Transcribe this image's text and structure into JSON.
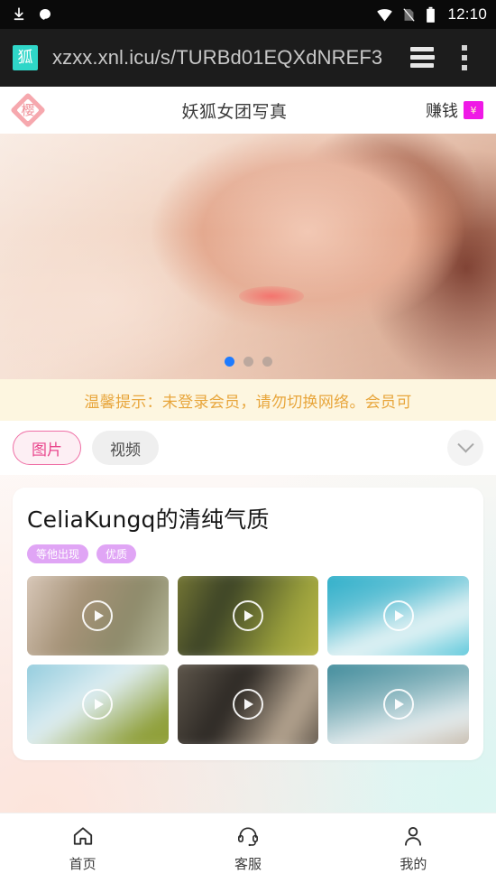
{
  "status_bar": {
    "time": "12:10",
    "left_icons": [
      "download-icon",
      "app-blob-icon"
    ],
    "right_icons": [
      "wifi-icon",
      "no-sim-icon",
      "battery-icon"
    ]
  },
  "browser": {
    "favicon_char": "狐",
    "url": "xzxx.xnl.icu/s/TURBd01EQXdNREF3",
    "tabs_icon": "tab-stack-icon",
    "menu_icon": "overflow-menu-icon"
  },
  "site_header": {
    "logo_char": "樱",
    "title": "妖狐女团写真",
    "earn_label": "赚钱",
    "earn_badge_char": "¥"
  },
  "banner": {
    "alt": "portrait-banner",
    "dots": [
      true,
      false,
      false
    ]
  },
  "notice": {
    "text": "温馨提示：未登录会员，请勿切换网络。会员可"
  },
  "tabs": {
    "items": [
      {
        "label": "图片",
        "active": true
      },
      {
        "label": "视频",
        "active": false
      }
    ],
    "expand_icon": "chevron-down-icon"
  },
  "card": {
    "title": "CeliaKungq的清纯气质",
    "tags": [
      "等他出现",
      "优质"
    ],
    "thumbnails": [
      {
        "id": 1,
        "play_icon": "play-icon",
        "c1": "#e8d8cd",
        "c2": "#8d8a6a",
        "c3": "#c9cdb0"
      },
      {
        "id": 2,
        "play_icon": "play-icon",
        "c1": "#8a8a3a",
        "c2": "#3b4226",
        "c3": "#c9c24d"
      },
      {
        "id": 3,
        "play_icon": "play-icon",
        "c1": "#1aa7c4",
        "c2": "#eaf5f6",
        "c3": "#2fb9d2"
      },
      {
        "id": 4,
        "play_icon": "play-icon",
        "c1": "#7ec3d8",
        "c2": "#dfeef2",
        "c3": "#94a33a"
      },
      {
        "id": 5,
        "play_icon": "play-icon",
        "c1": "#6d6457",
        "c2": "#2b2723",
        "c3": "#b9a893"
      },
      {
        "id": 6,
        "play_icon": "play-icon",
        "c1": "#2b7f91",
        "c2": "#e7eef0",
        "c3": "#b8a58f"
      }
    ]
  },
  "bottom_nav": {
    "items": [
      {
        "label": "首页",
        "icon": "home-icon"
      },
      {
        "label": "客服",
        "icon": "headset-icon"
      },
      {
        "label": "我的",
        "icon": "person-icon"
      }
    ]
  },
  "colors": {
    "accent_pink": "#e9458c",
    "tag_purple": "#e0a5f5",
    "notice_bg": "#fdf6e0",
    "notice_text": "#e8a63c",
    "dot_active": "#1e7bff",
    "earn_badge": "#ef19e6"
  }
}
